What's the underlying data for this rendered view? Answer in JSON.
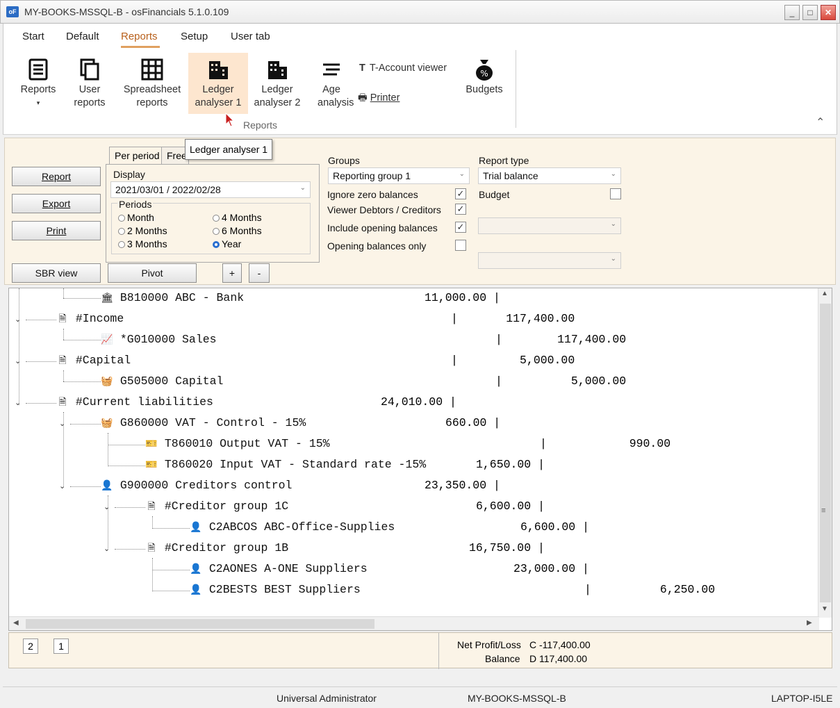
{
  "window": {
    "title": "MY-BOOKS-MSSQL-B - osFinancials 5.1.0.109",
    "app_icon": "oF"
  },
  "ribbon": {
    "tabs": [
      "Start",
      "Default",
      "Reports",
      "Setup",
      "User tab"
    ],
    "active_tab": "Reports",
    "buttons": {
      "reports": "Reports",
      "user_reports": "User reports",
      "spreadsheet_reports": "Spreadsheet reports",
      "ledger_analyser_1": "Ledger analyser 1",
      "ledger_analyser_2": "Ledger analyser 2",
      "age_analysis": "Age analysis",
      "t_account_viewer": "T-Account viewer",
      "printer": "Printer",
      "budgets": "Budgets"
    },
    "group_caption": "Reports"
  },
  "tooltip": "Ledger analyser 1",
  "actions": {
    "report": "Report",
    "export": "Export",
    "print": "Print",
    "sbr_view": "SBR view",
    "pivot": "Pivot",
    "plus": "+",
    "minus": "-"
  },
  "subtabs": {
    "per_period": "Per period",
    "free": "Free"
  },
  "display": {
    "label": "Display",
    "value": "2021/03/01 / 2022/02/28"
  },
  "periods": {
    "label": "Periods",
    "options": [
      "Month",
      "2 Months",
      "3 Months",
      "4 Months",
      "6 Months",
      "Year"
    ],
    "selected": "Year"
  },
  "groups": {
    "label": "Groups",
    "value": "Reporting group 1"
  },
  "report_type": {
    "label": "Report type",
    "value": "Trial balance"
  },
  "options": {
    "ignore_zero": {
      "label": "Ignore zero balances",
      "checked": true
    },
    "viewer_debtors": {
      "label": "Viewer  Debtors / Creditors",
      "checked": true
    },
    "include_opening": {
      "label": "Include opening balances",
      "checked": true
    },
    "opening_only": {
      "label": "Opening balances only",
      "checked": false
    },
    "budget": {
      "label": "Budget",
      "checked": false
    }
  },
  "tree": [
    {
      "text": "B810000 ABC - Bank",
      "amount": "11,000.00 |",
      "icon": "bank-icon"
    },
    {
      "text": "#Income",
      "amount": "|       117,400.00",
      "icon": "report-icon"
    },
    {
      "text": "*G010000 Sales",
      "amount": "|        117,400.00",
      "icon": "chart-icon"
    },
    {
      "text": "#Capital",
      "amount": "|         5,000.00",
      "icon": "report-icon"
    },
    {
      "text": "G505000 Capital",
      "amount": "|          5,000.00",
      "icon": "basket-icon"
    },
    {
      "text": "#Current liabilities",
      "amount": "24,010.00 |",
      "icon": "report-icon"
    },
    {
      "text": "G860000 VAT - Control - 15%",
      "amount": "660.00 |",
      "icon": "basket-icon"
    },
    {
      "text": "T860010 Output VAT - 15%",
      "amount": "|            990.00",
      "icon": "ticket-icon"
    },
    {
      "text": "T860020 Input VAT - Standard rate -15%",
      "amount": "1,650.00 |",
      "icon": "ticket-icon"
    },
    {
      "text": "G900000 Creditors control",
      "amount": "23,350.00 |",
      "icon": "person-icon"
    },
    {
      "text": "#Creditor group 1C",
      "amount": "6,600.00 |",
      "icon": "report-icon"
    },
    {
      "text": "C2ABCOS ABC-Office-Supplies",
      "amount": "6,600.00 |",
      "icon": "person-icon"
    },
    {
      "text": "#Creditor group 1B",
      "amount": "16,750.00 |",
      "icon": "report-icon"
    },
    {
      "text": "C2AONES A-ONE Suppliers",
      "amount": "23,000.00 |",
      "icon": "person-icon"
    },
    {
      "text": "C2BESTS BEST Suppliers",
      "amount": "|          6,250.00",
      "icon": "person-icon"
    }
  ],
  "pages": [
    "2",
    "1"
  ],
  "summary": {
    "net_label": "Net Profit/Loss",
    "net_value": "C -117,400.00",
    "balance_label": "Balance",
    "balance_value": "D 117,400.00"
  },
  "status": {
    "user": "Universal Administrator",
    "database": "MY-BOOKS-MSSQL-B",
    "machine": "LAPTOP-I5LE"
  }
}
